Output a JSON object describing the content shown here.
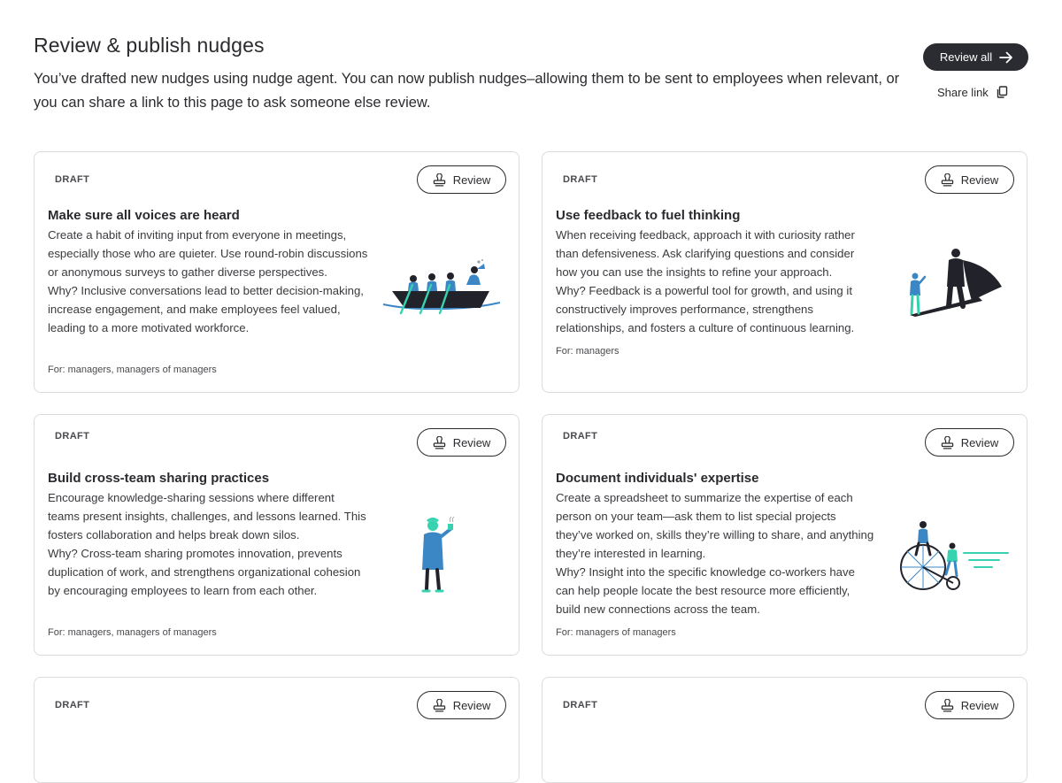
{
  "header": {
    "title": "Review & publish nudges",
    "description": "You’ve drafted new nudges using nudge agent. You can now publish nudges–allowing them to be sent to employees when relevant, or you can share a link to this page to ask someone else review.",
    "review_all_label": "Review all",
    "share_link_label": "Share link"
  },
  "colors": {
    "dark_button": "#2b2c31",
    "accent_teal": "#37d3b0",
    "accent_blue": "#3b86c4"
  },
  "cards": [
    {
      "status": "DRAFT",
      "review_label": "Review",
      "title": "Make sure all voices are heard",
      "body": "Create a habit of inviting input from everyone in meetings, especially those who are quieter. Use round-robin discussions or anonymous surveys to gather diverse perspectives.",
      "why": "Why? Inclusive conversations lead to better decision-making, increase engagement, and make employees feel valued, leading to a more motivated workforce.",
      "for": "For: managers, managers of managers",
      "illustration": "rowing-boat-team-illustration"
    },
    {
      "status": "DRAFT",
      "review_label": "Review",
      "title": "Use feedback to fuel thinking",
      "body": "When receiving feedback, approach it with curiosity rather than defensiveness. Ask clarifying questions and consider how you can use the insights to refine your approach.",
      "why": "Why? Feedback is a powerful tool for growth, and using it constructively improves performance, strengthens relationships, and fosters a culture of continuous learning.",
      "for": "For: managers",
      "illustration": "hero-shadow-illustration"
    },
    {
      "status": "DRAFT",
      "review_label": "Review",
      "title": "Build cross-team sharing practices",
      "body": "Encourage knowledge-sharing sessions where different teams present insights, challenges, and lessons learned. This fosters collaboration and helps break down silos.",
      "why": "Why? Cross-team sharing promotes innovation, prevents duplication of work, and strengthens organizational cohesion by encouraging employees to learn from each other.",
      "for": "For: managers, managers of managers",
      "illustration": "person-with-coffee-illustration"
    },
    {
      "status": "DRAFT",
      "review_label": "Review",
      "title": "Document individuals' expertise",
      "body": "Create a spreadsheet to summarize the expertise of each person on your team—ask them to list special projects they’ve worked on, skills they’re willing to share, and anything they’re interested in learning.",
      "why": "Why? Insight into the specific knowledge co-workers have can help people locate the best resource more efficiently, build new connections across the team.",
      "for": "For: managers of managers",
      "illustration": "penny-farthing-riders-illustration"
    },
    {
      "status": "DRAFT",
      "review_label": "Review"
    },
    {
      "status": "DRAFT",
      "review_label": "Review"
    }
  ],
  "icons": {
    "arrow": "arrow-right-icon",
    "copy": "copy-icon",
    "review": "stamp-icon"
  }
}
